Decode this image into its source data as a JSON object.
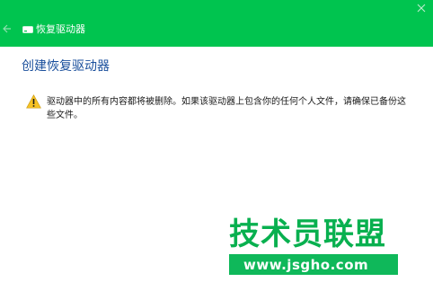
{
  "window": {
    "title": "恢复驱动器",
    "accent_color": "#00c44f",
    "back_icon": "back-arrow-icon",
    "close_icon": "close-icon",
    "title_icon": "drive-icon"
  },
  "main": {
    "heading": "创建恢复驱动器",
    "heading_color": "#1a4f9c",
    "warning_icon": "warning-icon",
    "message": "驱动器中的所有内容都将被删除。如果该驱动器上包含你的任何个人文件，请确保已备份这些文件。"
  },
  "watermark": {
    "text": "技术员联盟",
    "url": "www.jsgho.com",
    "color": "#08b04f"
  }
}
